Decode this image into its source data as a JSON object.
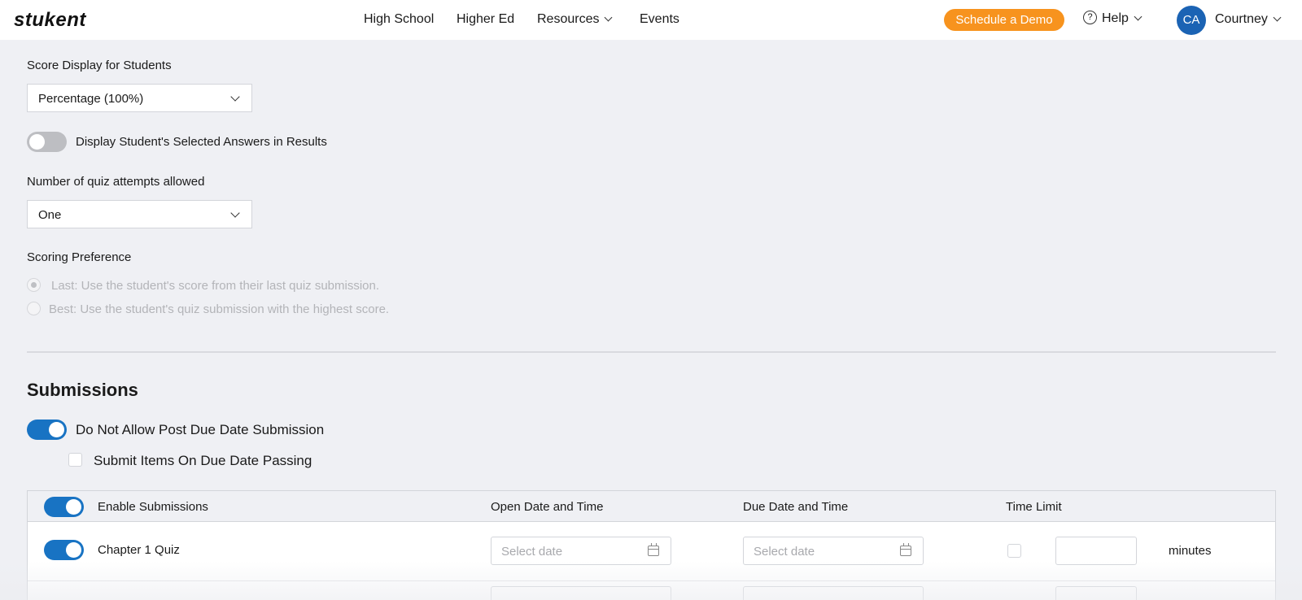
{
  "header": {
    "logo": "stukent",
    "nav": [
      "High School",
      "Higher Ed",
      "Resources",
      "Events"
    ],
    "demo_label": "Schedule a Demo",
    "help_label": "Help",
    "avatar_initials": "CA",
    "user_name": "Courtney",
    "accent": "#f7931e",
    "avatar_color": "#1b63b4"
  },
  "score_display": {
    "label": "Score Display for Students",
    "value": "Percentage (100%)"
  },
  "display_answers": {
    "label": "Display Student's Selected Answers in Results",
    "enabled": false
  },
  "attempts": {
    "label": "Number of quiz attempts allowed",
    "value": "One"
  },
  "scoring": {
    "label": "Scoring Preference",
    "options": [
      {
        "label": "Last: Use the student's score from their last quiz submission.",
        "selected": true
      },
      {
        "label": "Best: Use the student's quiz submission with the highest score.",
        "selected": false
      }
    ]
  },
  "submissions": {
    "title": "Submissions",
    "no_post_due": {
      "label": "Do Not Allow Post Due Date Submission",
      "enabled": true
    },
    "submit_on_due": {
      "label": "Submit Items On Due Date Passing",
      "checked": false
    },
    "table": {
      "headers": [
        "Enable Submissions",
        "Open Date and Time",
        "Due Date and Time",
        "Time Limit"
      ],
      "rows": [
        {
          "name": "Chapter 1 Quiz",
          "enabled": true,
          "open_placeholder": "Select date",
          "due_placeholder": "Select date",
          "time_limit_checked": false,
          "unit": "minutes"
        }
      ]
    },
    "toggle_color": "#1873c3"
  }
}
